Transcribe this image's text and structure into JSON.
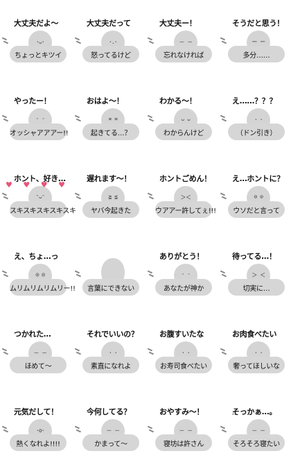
{
  "stickers": [
    {
      "top": "大丈夫だよ～",
      "face": "･ᴗ･",
      "bottom": "ちょっとキツイ"
    },
    {
      "top": "大丈夫だって",
      "face": "･.･",
      "bottom": "怒ってるけど"
    },
    {
      "top": "大丈夫ー！",
      "face": "－ －",
      "bottom": "忘れなければ"
    },
    {
      "top": "そうだと思う！",
      "face": "ー ー",
      "bottom": "多分……"
    },
    {
      "top": "やったー！",
      "face": "ᵕ ᵕ",
      "bottom": "オッシャアアアー!!"
    },
    {
      "top": "おはよ～！",
      "face": "≖ ≖",
      "bottom": "起きてる…？"
    },
    {
      "top": "わかる～！",
      "face": "ᴗ ᴗ",
      "bottom": "わからんけど"
    },
    {
      "top": "え……？？？",
      "face": "･ ･",
      "bottom": "（ドン引き）"
    },
    {
      "top": "ホント、好き…",
      "face": "ᵔᴗᵔ",
      "bottom": "スキスキスキスキスキ"
    },
    {
      "top": "遅れます～！",
      "face": "≧ ≦",
      "bottom": "ヤバ今起きた"
    },
    {
      "top": "ホントごめん！",
      "face": "＞＜",
      "bottom": "ウアアー許してぇ!!!"
    },
    {
      "top": "え…ホントに？",
      "face": "⊙ ⊙",
      "bottom": "ウソだと言って"
    },
    {
      "top": "え、ちょ…っ",
      "face": "◎ ◎",
      "bottom": "ムリムリムリムリー!!"
    },
    {
      "top": "",
      "face": "",
      "bottom": "言葉にできない"
    },
    {
      "top": "ありがとう！",
      "face": "ᵕ ᵕ",
      "bottom": "あなたが神か"
    },
    {
      "top": "待ってる…！",
      "face": "＞ ＜",
      "bottom": "切実に…"
    },
    {
      "top": "つかれた…",
      "face": "－ －",
      "bottom": "ほめて～"
    },
    {
      "top": "それでいいの？",
      "face": "･ ･",
      "bottom": "素直になれよ"
    },
    {
      "top": "お腹すいたな",
      "face": "･ ･",
      "bottom": "お寿司食べたい"
    },
    {
      "top": "お肉食べたい",
      "face": "･ ･",
      "bottom": "奢ってほしいな"
    },
    {
      "top": "元気だして！",
      "face": "･o･",
      "bottom": "熱くなれよ!!!!"
    },
    {
      "top": "今何してる？",
      "face": "－ －",
      "bottom": "かまって～"
    },
    {
      "top": "おやすみ～！",
      "face": "－ －",
      "bottom": "寝坊は許さん"
    },
    {
      "top": "そっかぁ…。",
      "face": "－ －",
      "bottom": "そろそろ寝たい"
    }
  ],
  "decor": {
    "hearts": "♥ ♥ ♥ ♥",
    "sleep": "ᶻᶻ"
  }
}
